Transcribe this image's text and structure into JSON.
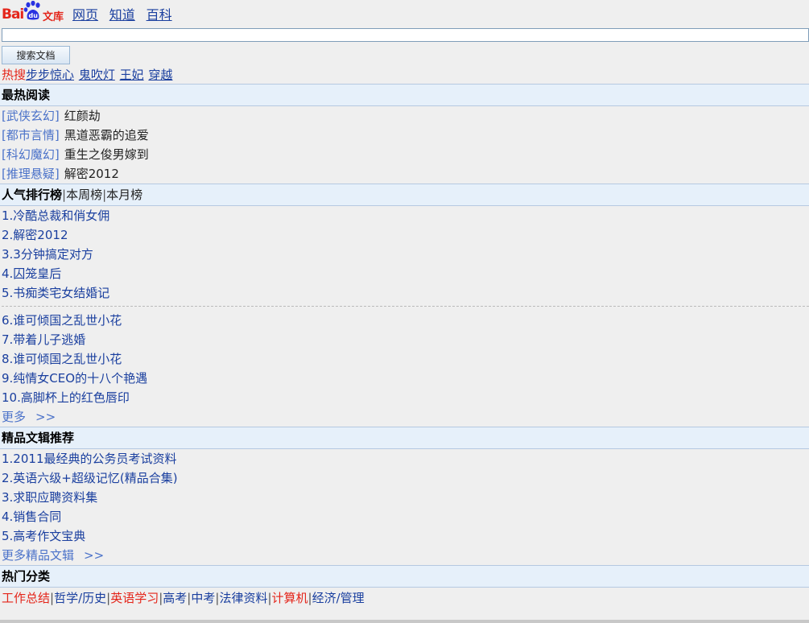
{
  "header": {
    "logo_text": "Bai",
    "logo_paw_text": "du",
    "logo_suffix": "文库",
    "nav": [
      "网页",
      "知道",
      "百科"
    ]
  },
  "search": {
    "value": "",
    "button_label": "搜索文档"
  },
  "hot_search": {
    "label": "热搜",
    "items": [
      "步步惊心",
      "鬼吹灯",
      "王妃",
      "穿越"
    ]
  },
  "hottest_reading": {
    "title": "最热阅读",
    "items": [
      {
        "category": "[武侠玄幻]",
        "title": "红颜劫"
      },
      {
        "category": "[都市言情]",
        "title": "黑道恶霸的追爱"
      },
      {
        "category": "[科幻魔幻]",
        "title": "重生之俊男嫁到"
      },
      {
        "category": "[推理悬疑]",
        "title": "解密2012"
      }
    ]
  },
  "ranking": {
    "title": "人气排行榜",
    "tabs": [
      "本周榜",
      "本月榜"
    ],
    "sep": "|",
    "items_top": [
      "1.冷酷总裁和俏女佣",
      "2.解密2012",
      "3.3分钟搞定对方",
      "4.囚笼皇后",
      "5.书痴类宅女结婚记"
    ],
    "items_bottom": [
      "6.谁可倾国之乱世小花",
      "7.带着儿子逃婚",
      "8.谁可倾国之乱世小花",
      "9.纯情女CEO的十八个艳遇",
      "10.高脚杯上的红色唇印"
    ],
    "more_label": "更多",
    "more_arrow": ">>"
  },
  "featured": {
    "title": "精品文辑推荐",
    "items": [
      "1.2011最经典的公务员考试资料",
      "2.英语六级+超级记忆(精品合集)",
      "3.求职应聘资料集",
      "4.销售合同",
      "5.高考作文宝典"
    ],
    "more_label": "更多精品文辑",
    "more_arrow": ">>"
  },
  "categories": {
    "title": "热门分类",
    "sep": "|",
    "items": [
      {
        "label": "工作总结",
        "highlight": true
      },
      {
        "label": "哲学/历史",
        "highlight": false
      },
      {
        "label": "英语学习",
        "highlight": true
      },
      {
        "label": "高考",
        "highlight": false
      },
      {
        "label": "中考",
        "highlight": false
      },
      {
        "label": "法律资料",
        "highlight": false
      },
      {
        "label": "计算机",
        "highlight": true
      },
      {
        "label": "经济/管理",
        "highlight": false
      }
    ]
  },
  "colors": {
    "brand_red": "#e4251a",
    "link_blue": "#1a3f9f",
    "category_blue": "#4b72c9",
    "section_bg": "#e6f0fa",
    "page_bg": "#efefef"
  }
}
